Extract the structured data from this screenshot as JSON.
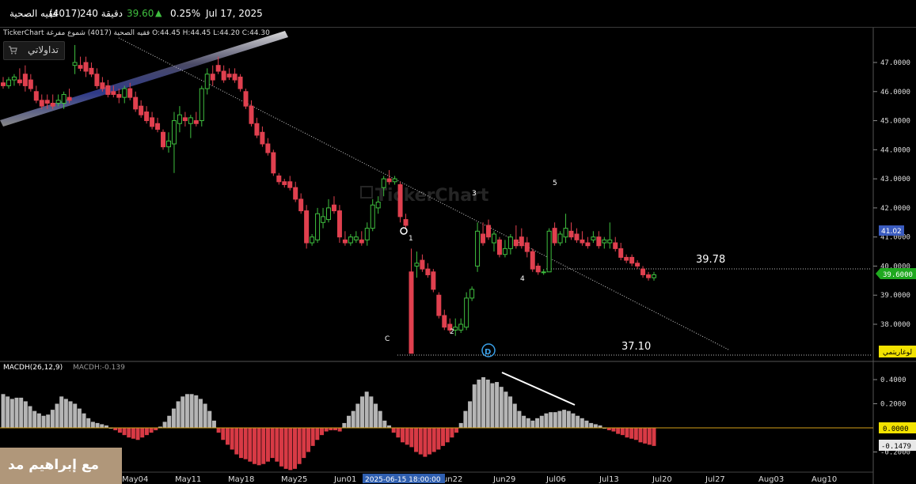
{
  "topbar": {
    "symbol_name": "فقيه الصحية",
    "symbol_code": "(4017)",
    "interval": "240 دقيقة",
    "last_price": "39.60",
    "change_pct": "0.25%",
    "date": "Jul 17, 2025"
  },
  "chart_header": {
    "text": "TickerChart فقيه الصحية (4017) شموع مفرغة O:44.45 H:44.45 L:44.20 C:44.30"
  },
  "broker_button": {
    "label": "تداولاتي"
  },
  "watermark": {
    "brand": "TickerChart",
    "author": "مع إبراهيم مد"
  },
  "price_axis": {
    "ticks": [
      "47.0000",
      "46.0000",
      "45.0000",
      "44.0000",
      "43.0000",
      "42.0000",
      "41.0000",
      "40.0000",
      "39.0000",
      "38.0000"
    ],
    "badge_41": "41.02",
    "badge_last": "39.6000",
    "badge_log": "لوغاريتمي"
  },
  "macd_axis": {
    "ticks": [
      "0.4000",
      "0.2000",
      "0.0000",
      "-0.2000"
    ],
    "badge_zero": "0.0000",
    "badge_last": "-0.1479"
  },
  "macd_header": {
    "title": "MACDH(26,12,9)",
    "value": "MACDH:-0.139"
  },
  "time_axis": {
    "labels": [
      "May04",
      "May11",
      "May18",
      "May25",
      "Jun01",
      "Jun22",
      "Jun29",
      "Jul06",
      "Jul13",
      "Jul20",
      "Jul27",
      "Aug03",
      "Aug10"
    ],
    "highlight": "2025-06-15 18:00:00"
  },
  "annotations": {
    "level_high": "39.78",
    "level_low": "37.10",
    "wave_1": "1",
    "wave_2": "2",
    "wave_3": "3",
    "wave_4": "4",
    "wave_5": "5",
    "wave_c": "C",
    "wave_d": "D"
  },
  "colors": {
    "up": "#3fbf3f",
    "down": "#e0404f",
    "macd_pos": "#b5b5b5",
    "macd_neg": "#d83a45",
    "zero_line": "#d4a017",
    "last_badge": "#1fa81f"
  },
  "chart_data": {
    "type": "candlestick",
    "ylim": [
      37.0,
      47.6
    ],
    "candles": [
      [
        46.3,
        46.5,
        46.1,
        46.2
      ],
      [
        46.2,
        46.5,
        46.1,
        46.4
      ],
      [
        46.4,
        46.6,
        46.2,
        46.5
      ],
      [
        46.4,
        46.8,
        46.2,
        46.3
      ],
      [
        46.6,
        46.9,
        46.0,
        46.2
      ],
      [
        46.4,
        46.6,
        46.0,
        46.1
      ],
      [
        46.0,
        46.2,
        45.6,
        45.7
      ],
      [
        45.7,
        45.9,
        45.4,
        45.5
      ],
      [
        45.7,
        45.9,
        45.4,
        45.6
      ],
      [
        45.6,
        45.9,
        45.4,
        45.5
      ],
      [
        45.6,
        45.9,
        45.5,
        45.7
      ],
      [
        45.6,
        46.0,
        45.4,
        45.9
      ],
      [
        45.8,
        46.1,
        45.6,
        45.7
      ],
      [
        46.9,
        47.6,
        46.6,
        47.0
      ],
      [
        46.9,
        47.2,
        46.7,
        46.8
      ],
      [
        47.0,
        47.2,
        46.5,
        46.7
      ],
      [
        46.8,
        47.0,
        46.5,
        46.6
      ],
      [
        46.6,
        46.8,
        46.1,
        46.2
      ],
      [
        46.3,
        46.5,
        46.0,
        46.1
      ],
      [
        46.2,
        46.4,
        45.8,
        45.9
      ],
      [
        46.0,
        46.2,
        45.8,
        45.9
      ],
      [
        45.9,
        46.1,
        45.6,
        45.8
      ],
      [
        45.8,
        46.2,
        45.6,
        46.1
      ],
      [
        46.1,
        46.3,
        45.7,
        45.8
      ],
      [
        45.8,
        46.0,
        45.3,
        45.4
      ],
      [
        45.5,
        45.7,
        45.1,
        45.2
      ],
      [
        45.3,
        45.5,
        44.9,
        45.0
      ],
      [
        45.1,
        45.3,
        44.7,
        44.8
      ],
      [
        44.9,
        45.1,
        44.6,
        44.7
      ],
      [
        44.6,
        44.7,
        44.0,
        44.1
      ],
      [
        44.1,
        44.6,
        43.9,
        44.3
      ],
      [
        44.2,
        45.3,
        43.2,
        45.0
      ],
      [
        44.9,
        45.5,
        44.6,
        45.2
      ],
      [
        45.1,
        45.3,
        44.8,
        45.0
      ],
      [
        44.9,
        45.2,
        44.4,
        45.1
      ],
      [
        45.0,
        45.3,
        44.8,
        44.9
      ],
      [
        45.0,
        46.2,
        44.8,
        46.1
      ],
      [
        46.1,
        46.8,
        45.9,
        46.6
      ],
      [
        46.6,
        46.9,
        46.2,
        46.4
      ],
      [
        46.9,
        47.2,
        46.6,
        46.7
      ],
      [
        46.7,
        46.9,
        46.3,
        46.4
      ],
      [
        46.6,
        46.8,
        46.4,
        46.5
      ],
      [
        46.6,
        46.8,
        46.3,
        46.4
      ],
      [
        46.5,
        46.6,
        46.0,
        46.1
      ],
      [
        46.0,
        46.1,
        45.4,
        45.5
      ],
      [
        45.5,
        45.7,
        44.8,
        44.9
      ],
      [
        44.9,
        45.1,
        44.4,
        44.5
      ],
      [
        44.6,
        44.8,
        44.1,
        44.2
      ],
      [
        44.2,
        44.4,
        43.8,
        43.9
      ],
      [
        43.9,
        44.0,
        43.1,
        43.2
      ],
      [
        43.1,
        43.2,
        42.8,
        42.9
      ],
      [
        42.9,
        43.0,
        42.7,
        42.8
      ],
      [
        42.9,
        43.1,
        42.6,
        42.7
      ],
      [
        42.7,
        42.9,
        42.2,
        42.3
      ],
      [
        42.3,
        42.5,
        41.8,
        41.9
      ],
      [
        41.9,
        42.1,
        40.6,
        40.8
      ],
      [
        40.8,
        41.1,
        40.7,
        41.0
      ],
      [
        40.9,
        42.0,
        40.8,
        41.8
      ],
      [
        41.5,
        42.0,
        41.3,
        41.7
      ],
      [
        41.6,
        42.3,
        41.5,
        42.0
      ],
      [
        42.1,
        42.4,
        41.8,
        41.9
      ],
      [
        41.9,
        42.1,
        40.8,
        41.0
      ],
      [
        40.9,
        41.2,
        40.7,
        40.8
      ],
      [
        40.8,
        41.1,
        40.7,
        41.0
      ],
      [
        40.9,
        41.2,
        40.8,
        41.0
      ],
      [
        40.9,
        41.2,
        40.7,
        40.8
      ],
      [
        40.9,
        41.5,
        40.7,
        41.3
      ],
      [
        41.3,
        42.3,
        41.2,
        42.1
      ],
      [
        42.0,
        42.4,
        41.8,
        42.2
      ],
      [
        42.7,
        43.1,
        42.4,
        43.0
      ],
      [
        43.0,
        43.3,
        42.8,
        42.9
      ],
      [
        42.9,
        43.1,
        42.8,
        43.0
      ],
      [
        42.8,
        42.9,
        41.5,
        41.7
      ],
      [
        41.6,
        41.8,
        41.3,
        41.4
      ],
      [
        39.8,
        40.6,
        37.0,
        37.0
      ],
      [
        40.0,
        40.5,
        39.6,
        40.1
      ],
      [
        40.2,
        40.4,
        39.8,
        39.9
      ],
      [
        39.9,
        40.1,
        39.6,
        39.7
      ],
      [
        39.8,
        39.9,
        39.1,
        39.2
      ],
      [
        39.0,
        39.1,
        38.2,
        38.3
      ],
      [
        38.3,
        38.5,
        37.8,
        37.9
      ],
      [
        38.0,
        38.2,
        37.7,
        37.8
      ],
      [
        37.8,
        38.2,
        37.6,
        37.9
      ],
      [
        37.8,
        38.2,
        37.7,
        38.0
      ],
      [
        37.9,
        39.1,
        37.8,
        38.9
      ],
      [
        38.9,
        39.3,
        38.8,
        39.2
      ],
      [
        40.0,
        41.5,
        39.8,
        41.2
      ],
      [
        41.1,
        41.5,
        40.7,
        40.8
      ],
      [
        41.4,
        41.6,
        40.9,
        41.0
      ],
      [
        40.8,
        41.2,
        40.5,
        41.1
      ],
      [
        40.9,
        41.0,
        40.3,
        40.4
      ],
      [
        40.4,
        40.9,
        40.3,
        40.6
      ],
      [
        40.6,
        41.1,
        40.4,
        41.0
      ],
      [
        40.9,
        41.4,
        40.6,
        40.7
      ],
      [
        41.0,
        41.3,
        40.6,
        40.7
      ],
      [
        40.8,
        41.0,
        40.3,
        40.5
      ],
      [
        40.5,
        40.6,
        39.8,
        39.9
      ],
      [
        40.0,
        40.1,
        39.7,
        39.8
      ],
      [
        39.8,
        39.9,
        39.7,
        39.8
      ],
      [
        39.8,
        41.3,
        39.8,
        41.2
      ],
      [
        41.3,
        41.5,
        40.7,
        40.8
      ],
      [
        40.8,
        41.2,
        40.7,
        41.1
      ],
      [
        41.0,
        41.8,
        40.8,
        41.3
      ],
      [
        41.2,
        41.5,
        40.9,
        41.0
      ],
      [
        41.1,
        41.3,
        40.8,
        40.9
      ],
      [
        40.9,
        41.2,
        40.7,
        40.8
      ],
      [
        40.8,
        41.0,
        40.6,
        40.7
      ],
      [
        40.9,
        41.2,
        40.8,
        41.0
      ],
      [
        41.0,
        41.2,
        40.6,
        40.7
      ],
      [
        40.8,
        41.0,
        40.6,
        40.9
      ],
      [
        40.8,
        41.5,
        40.6,
        40.9
      ],
      [
        40.8,
        41.0,
        40.5,
        40.6
      ],
      [
        40.6,
        40.8,
        40.2,
        40.3
      ],
      [
        40.3,
        40.4,
        40.1,
        40.2
      ],
      [
        40.3,
        40.4,
        40.0,
        40.1
      ],
      [
        40.1,
        40.2,
        39.9,
        40.0
      ],
      [
        39.9,
        40.0,
        39.6,
        39.7
      ],
      [
        39.7,
        39.8,
        39.5,
        39.6
      ],
      [
        39.6,
        39.8,
        39.5,
        39.7
      ]
    ],
    "macd_hist": [
      0.28,
      0.26,
      0.24,
      0.25,
      0.25,
      0.22,
      0.18,
      0.14,
      0.12,
      0.1,
      0.11,
      0.15,
      0.2,
      0.26,
      0.24,
      0.22,
      0.2,
      0.16,
      0.12,
      0.08,
      0.05,
      0.04,
      0.03,
      0.02,
      0.0,
      -0.02,
      -0.04,
      -0.06,
      -0.08,
      -0.09,
      -0.1,
      -0.08,
      -0.06,
      -0.04,
      -0.02,
      0.01,
      0.05,
      0.1,
      0.16,
      0.22,
      0.26,
      0.28,
      0.28,
      0.27,
      0.24,
      0.2,
      0.14,
      0.06,
      -0.04,
      -0.1,
      -0.14,
      -0.18,
      -0.22,
      -0.25,
      -0.26,
      -0.28,
      -0.3,
      -0.31,
      -0.3,
      -0.28,
      -0.25,
      -0.28,
      -0.32,
      -0.34,
      -0.35,
      -0.34,
      -0.3,
      -0.25,
      -0.2,
      -0.15,
      -0.1,
      -0.06,
      -0.03,
      -0.02,
      -0.02,
      -0.03,
      0.04,
      0.1,
      0.14,
      0.2,
      0.26,
      0.3,
      0.26,
      0.2,
      0.14,
      0.06,
      0.02,
      -0.04,
      -0.08,
      -0.12,
      -0.14,
      -0.16,
      -0.2,
      -0.22,
      -0.24,
      -0.22,
      -0.2,
      -0.18,
      -0.15,
      -0.12,
      -0.08,
      -0.04,
      0.04,
      0.14,
      0.22,
      0.36,
      0.4,
      0.42,
      0.4,
      0.37,
      0.38,
      0.34,
      0.3,
      0.26,
      0.2,
      0.14,
      0.1,
      0.08,
      0.06,
      0.08,
      0.1,
      0.12,
      0.13,
      0.13,
      0.14,
      0.15,
      0.14,
      0.12,
      0.1,
      0.08,
      0.06,
      0.04,
      0.03,
      0.02,
      0.0,
      -0.02,
      -0.03,
      -0.05,
      -0.06,
      -0.08,
      -0.09,
      -0.1,
      -0.12,
      -0.13,
      -0.14,
      -0.15
    ]
  }
}
